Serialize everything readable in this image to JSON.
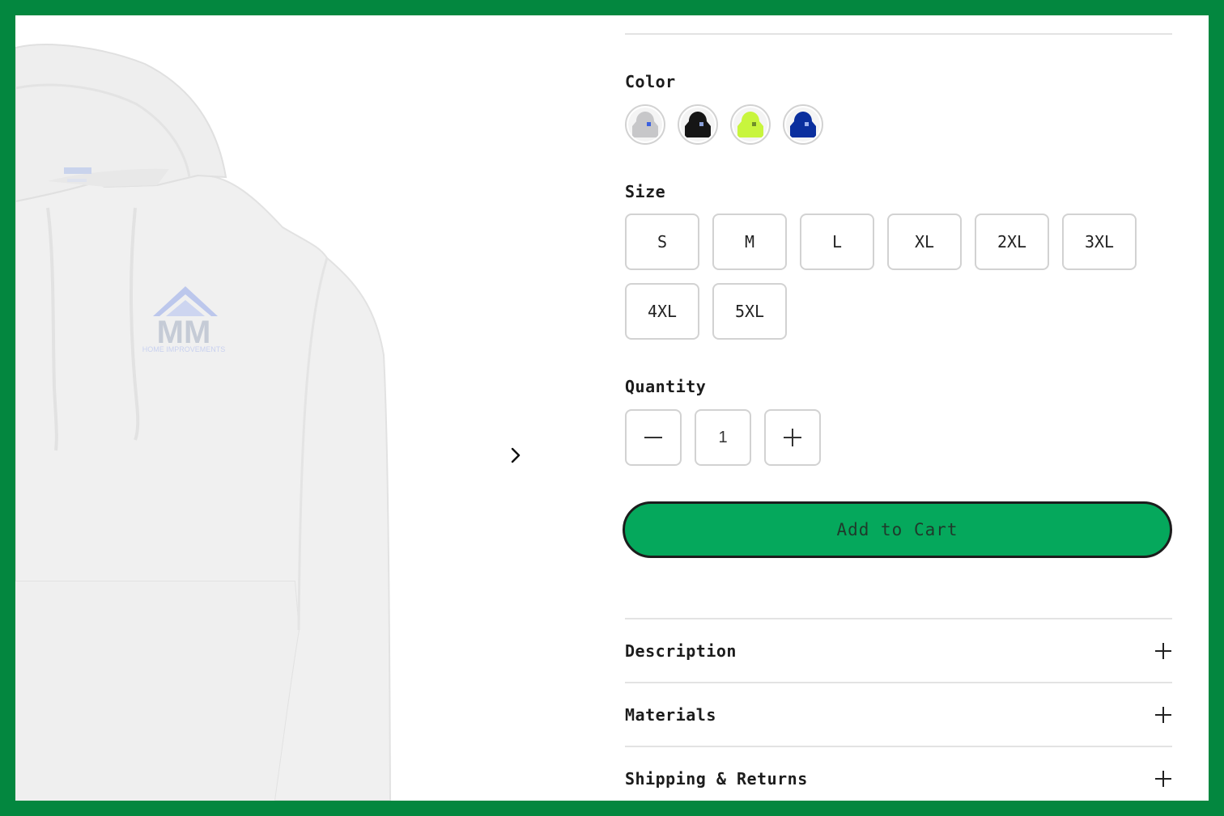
{
  "colors": {
    "frame_border": "#03873f",
    "add_to_cart_bg": "#05a85c",
    "swatch_colors": [
      "#c7c7c9",
      "#161616",
      "#c8f53d",
      "#0a2f9e"
    ]
  },
  "gallery": {
    "next_icon": "chevron-right-icon",
    "logo_text_main": "MM",
    "logo_text_sub": "HOME IMPROVEMENTS"
  },
  "color_option": {
    "label": "Color",
    "swatches": [
      {
        "name": "Grey",
        "color": "#c7c7c9"
      },
      {
        "name": "Black",
        "color": "#161616"
      },
      {
        "name": "Safety Green",
        "color": "#c8f53d"
      },
      {
        "name": "Royal Blue",
        "color": "#0a2f9e"
      }
    ]
  },
  "size_option": {
    "label": "Size",
    "sizes": [
      "S",
      "M",
      "L",
      "XL",
      "2XL",
      "3XL",
      "4XL",
      "5XL"
    ]
  },
  "quantity": {
    "label": "Quantity",
    "value": "1",
    "decrement_icon": "minus-icon",
    "increment_icon": "plus-icon"
  },
  "cart": {
    "add_label": "Add to Cart"
  },
  "accordion": [
    {
      "title": "Description",
      "icon": "plus-icon"
    },
    {
      "title": "Materials",
      "icon": "plus-icon"
    },
    {
      "title": "Shipping & Returns",
      "icon": "plus-icon"
    }
  ]
}
